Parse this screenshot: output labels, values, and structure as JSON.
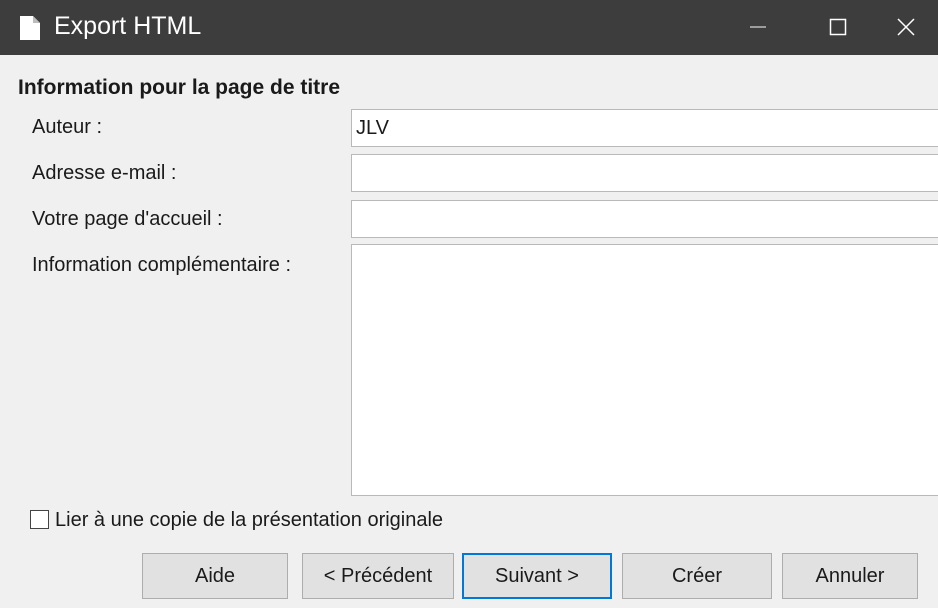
{
  "window": {
    "title": "Export HTML",
    "controls": [
      "minimize",
      "maximize",
      "close"
    ]
  },
  "section": {
    "heading": "Information pour la page de titre"
  },
  "fields": [
    {
      "label": "Auteur :",
      "value": "JLV"
    },
    {
      "label": "Adresse e-mail :",
      "value": ""
    },
    {
      "label": "Votre page d'accueil :",
      "value": ""
    },
    {
      "label": "Information complémentaire :",
      "value": ""
    }
  ],
  "checkbox": {
    "label": "Lier à une copie de la présentation originale",
    "checked": false
  },
  "buttons": {
    "help": "Aide",
    "previous": "< Précédent",
    "next": "Suivant >",
    "create": "Créer",
    "cancel": "Annuler"
  },
  "colors": {
    "titlebar": "#3d3d3d",
    "dialog_bg": "#f0f0f0",
    "default_button_border": "#0078d7"
  }
}
